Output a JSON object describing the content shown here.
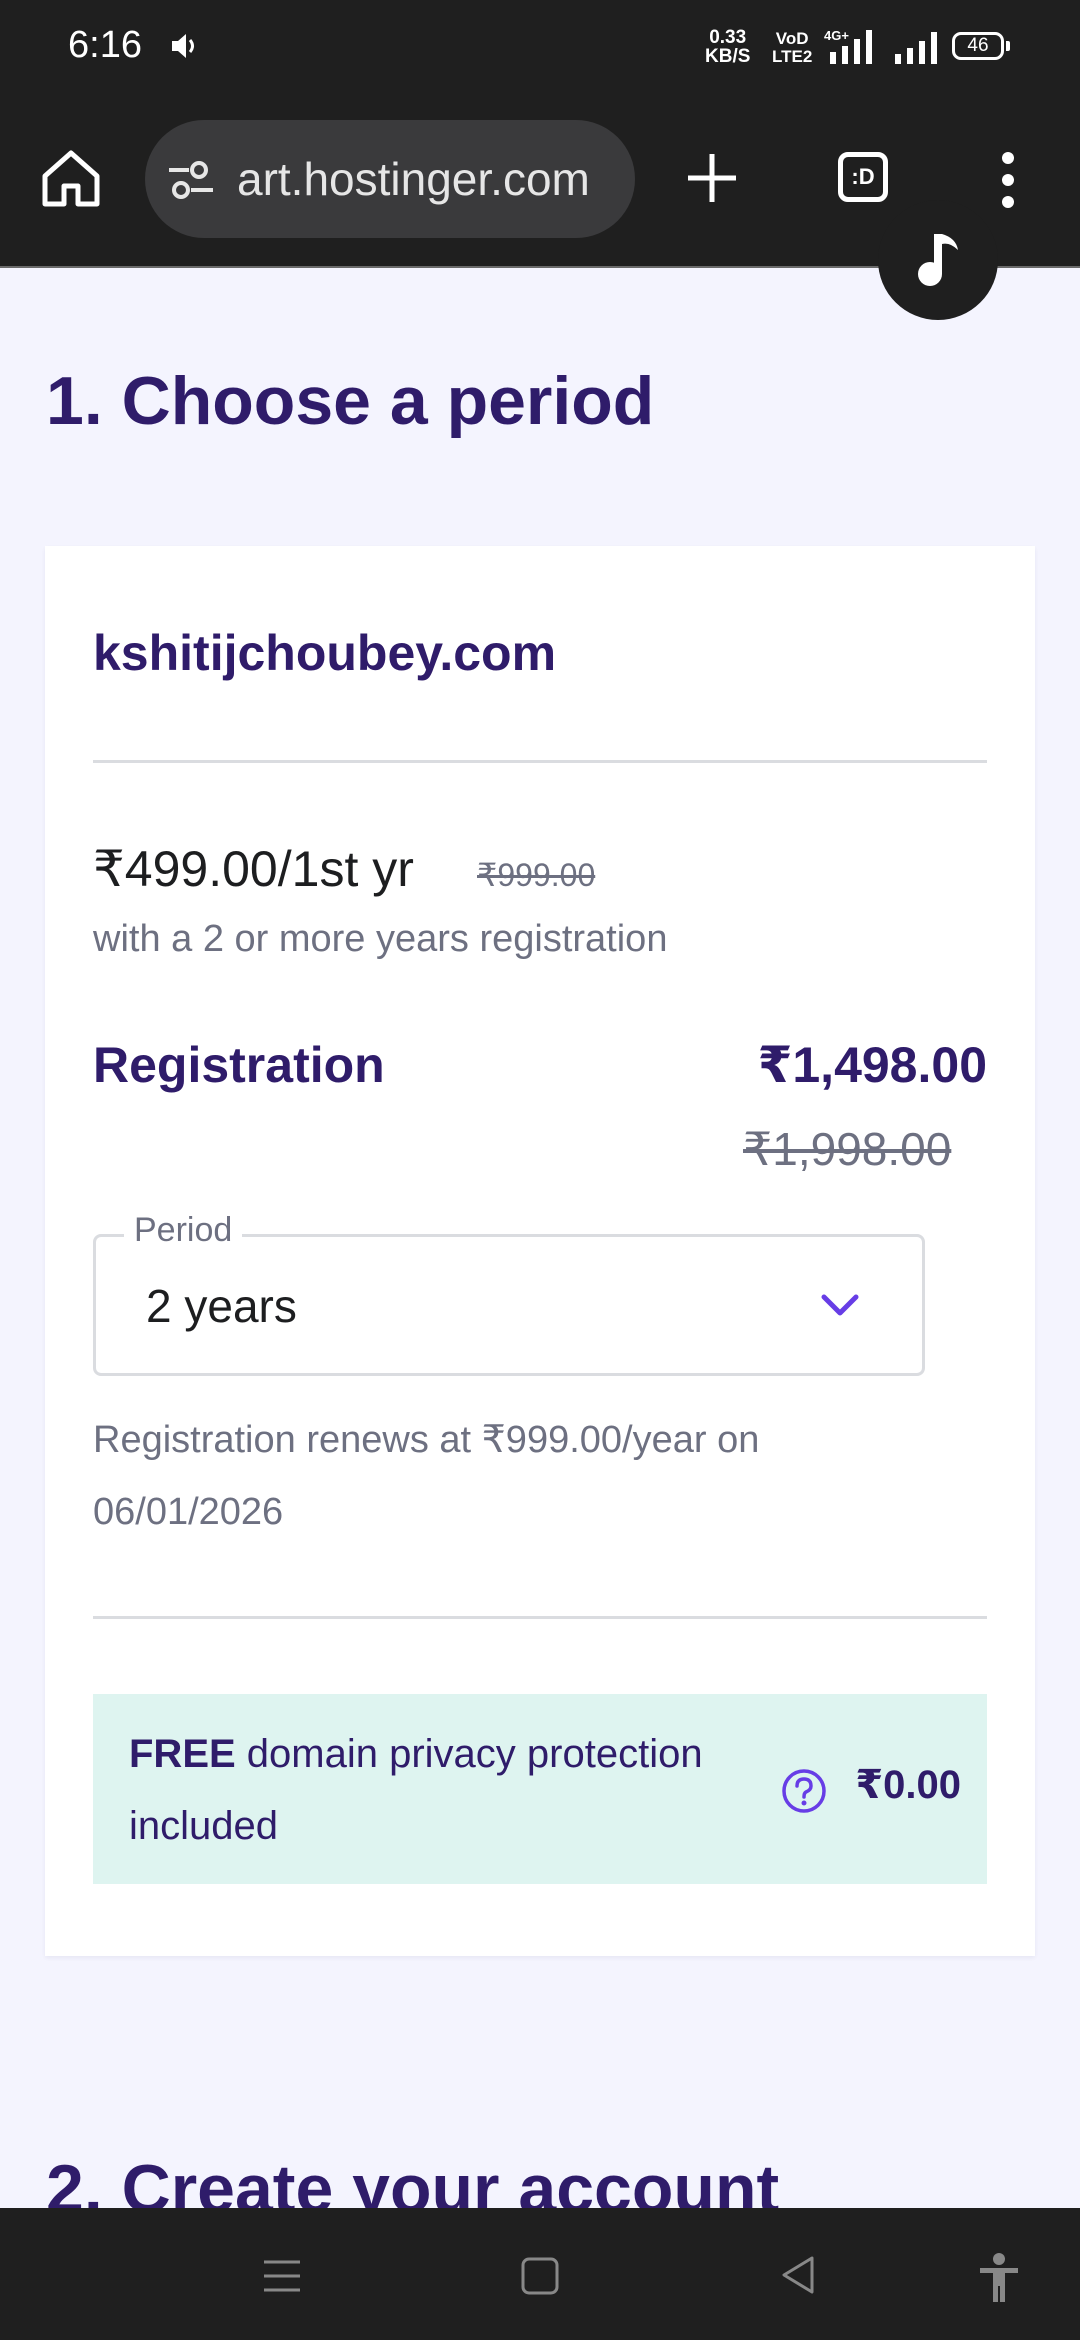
{
  "status_bar": {
    "time": "6:16",
    "net_speed_value": "0.33",
    "net_speed_unit": "KB/S",
    "volte_top": "VoD",
    "volte_bottom": "LTE2",
    "network_type": "4G+",
    "battery": "46"
  },
  "browser": {
    "url": "art.hostinger.com",
    "tab_switcher_label": ":D"
  },
  "page": {
    "section1_title": "1. Choose a period",
    "domain_name": "kshitijchoubey.com",
    "price_main": "₹499.00/1st yr",
    "price_original": "₹999.00",
    "price_note": "with a 2 or more years registration",
    "registration_label": "Registration",
    "registration_price": "₹1,498.00",
    "registration_original_price": "₹1,998.00",
    "period_label": "Period",
    "period_value": "2 years",
    "renewal_note": "Registration renews at ₹999.00/year on 06/01/2026",
    "privacy_free": "FREE",
    "privacy_text": " domain privacy protection included",
    "privacy_price": "₹0.00",
    "section2_title": "2. Create your account"
  },
  "colors": {
    "brand_dark": "#2f1c6a",
    "accent": "#673de6",
    "page_bg": "#f4f4fe",
    "privacy_bg": "#def4f0"
  }
}
